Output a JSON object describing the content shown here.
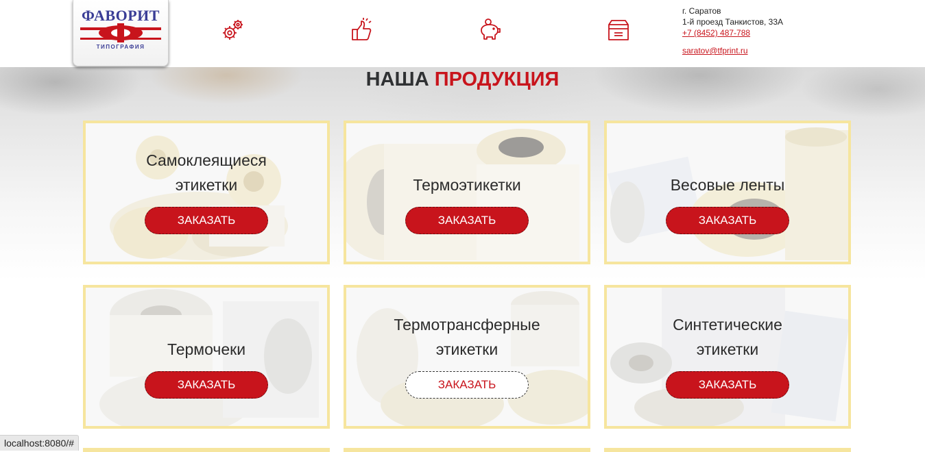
{
  "logo": {
    "title": "ФАВОРИТ",
    "letter": "Ф",
    "subtitle": "ТИПОГРАФИЯ"
  },
  "header_icons": [
    "gears-icon",
    "thumbs-up-icon",
    "piggy-bank-icon",
    "box-icon"
  ],
  "contacts": {
    "city": "г. Саратов",
    "address": "1-й проезд Танкистов, 33А",
    "phone": "+7 (8452) 487-788",
    "email": "saratov@tfprint.ru"
  },
  "section": {
    "title_dark": "НАША",
    "title_red": "ПРОДУКЦИЯ"
  },
  "products": [
    {
      "line1": "Самоклеящиеся",
      "line2": "этикетки",
      "button": "ЗАКАЗАТЬ"
    },
    {
      "line1": "",
      "line2": "Термоэтикетки",
      "button": "ЗАКАЗАТЬ"
    },
    {
      "line1": "",
      "line2": "Весовые ленты",
      "button": "ЗАКАЗАТЬ"
    },
    {
      "line1": "",
      "line2": "Термочеки",
      "button": "ЗАКАЗАТЬ"
    },
    {
      "line1": "Термотрансферные",
      "line2": "этикетки",
      "button": "ЗАКАЗАТЬ"
    },
    {
      "line1": "Синтетические",
      "line2": "этикетки",
      "button": "ЗАКАЗАТЬ"
    }
  ],
  "status_bar": "localhost:8080/#",
  "colors": {
    "accent": "#c8141c",
    "card_border": "#f6e59e",
    "logo_blue": "#3a3d96"
  }
}
